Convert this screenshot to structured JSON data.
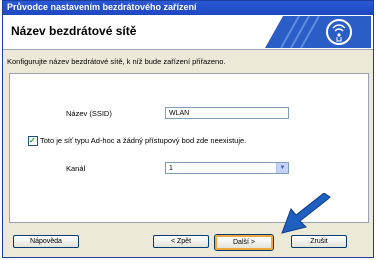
{
  "window": {
    "title": "Průvodce nastavením bezdrátového zařízení"
  },
  "banner": {
    "heading": "Název bezdrátové sítě",
    "logo_icon": "wireless-signal-icon"
  },
  "description": "Konfigurujte název bezdrátové sítě, k níž bude zařízení přiřazeno.",
  "form": {
    "ssid_label": "Název (SSID)",
    "ssid_value": "WLAN",
    "adhoc_checked": true,
    "adhoc_label": "Toto je síť typu Ad-hoc a žádný přístupový bod zde neexistuje.",
    "channel_label": "Kanál",
    "channel_value": "1"
  },
  "buttons": {
    "help": "Nápověda",
    "back": "< Zpět",
    "next": "Další >",
    "cancel": "Zrušit"
  },
  "colors": {
    "title_bar": "#1f47c0",
    "pointer_arrow": "#1e5fbf",
    "logo": "#2a5ec6"
  }
}
